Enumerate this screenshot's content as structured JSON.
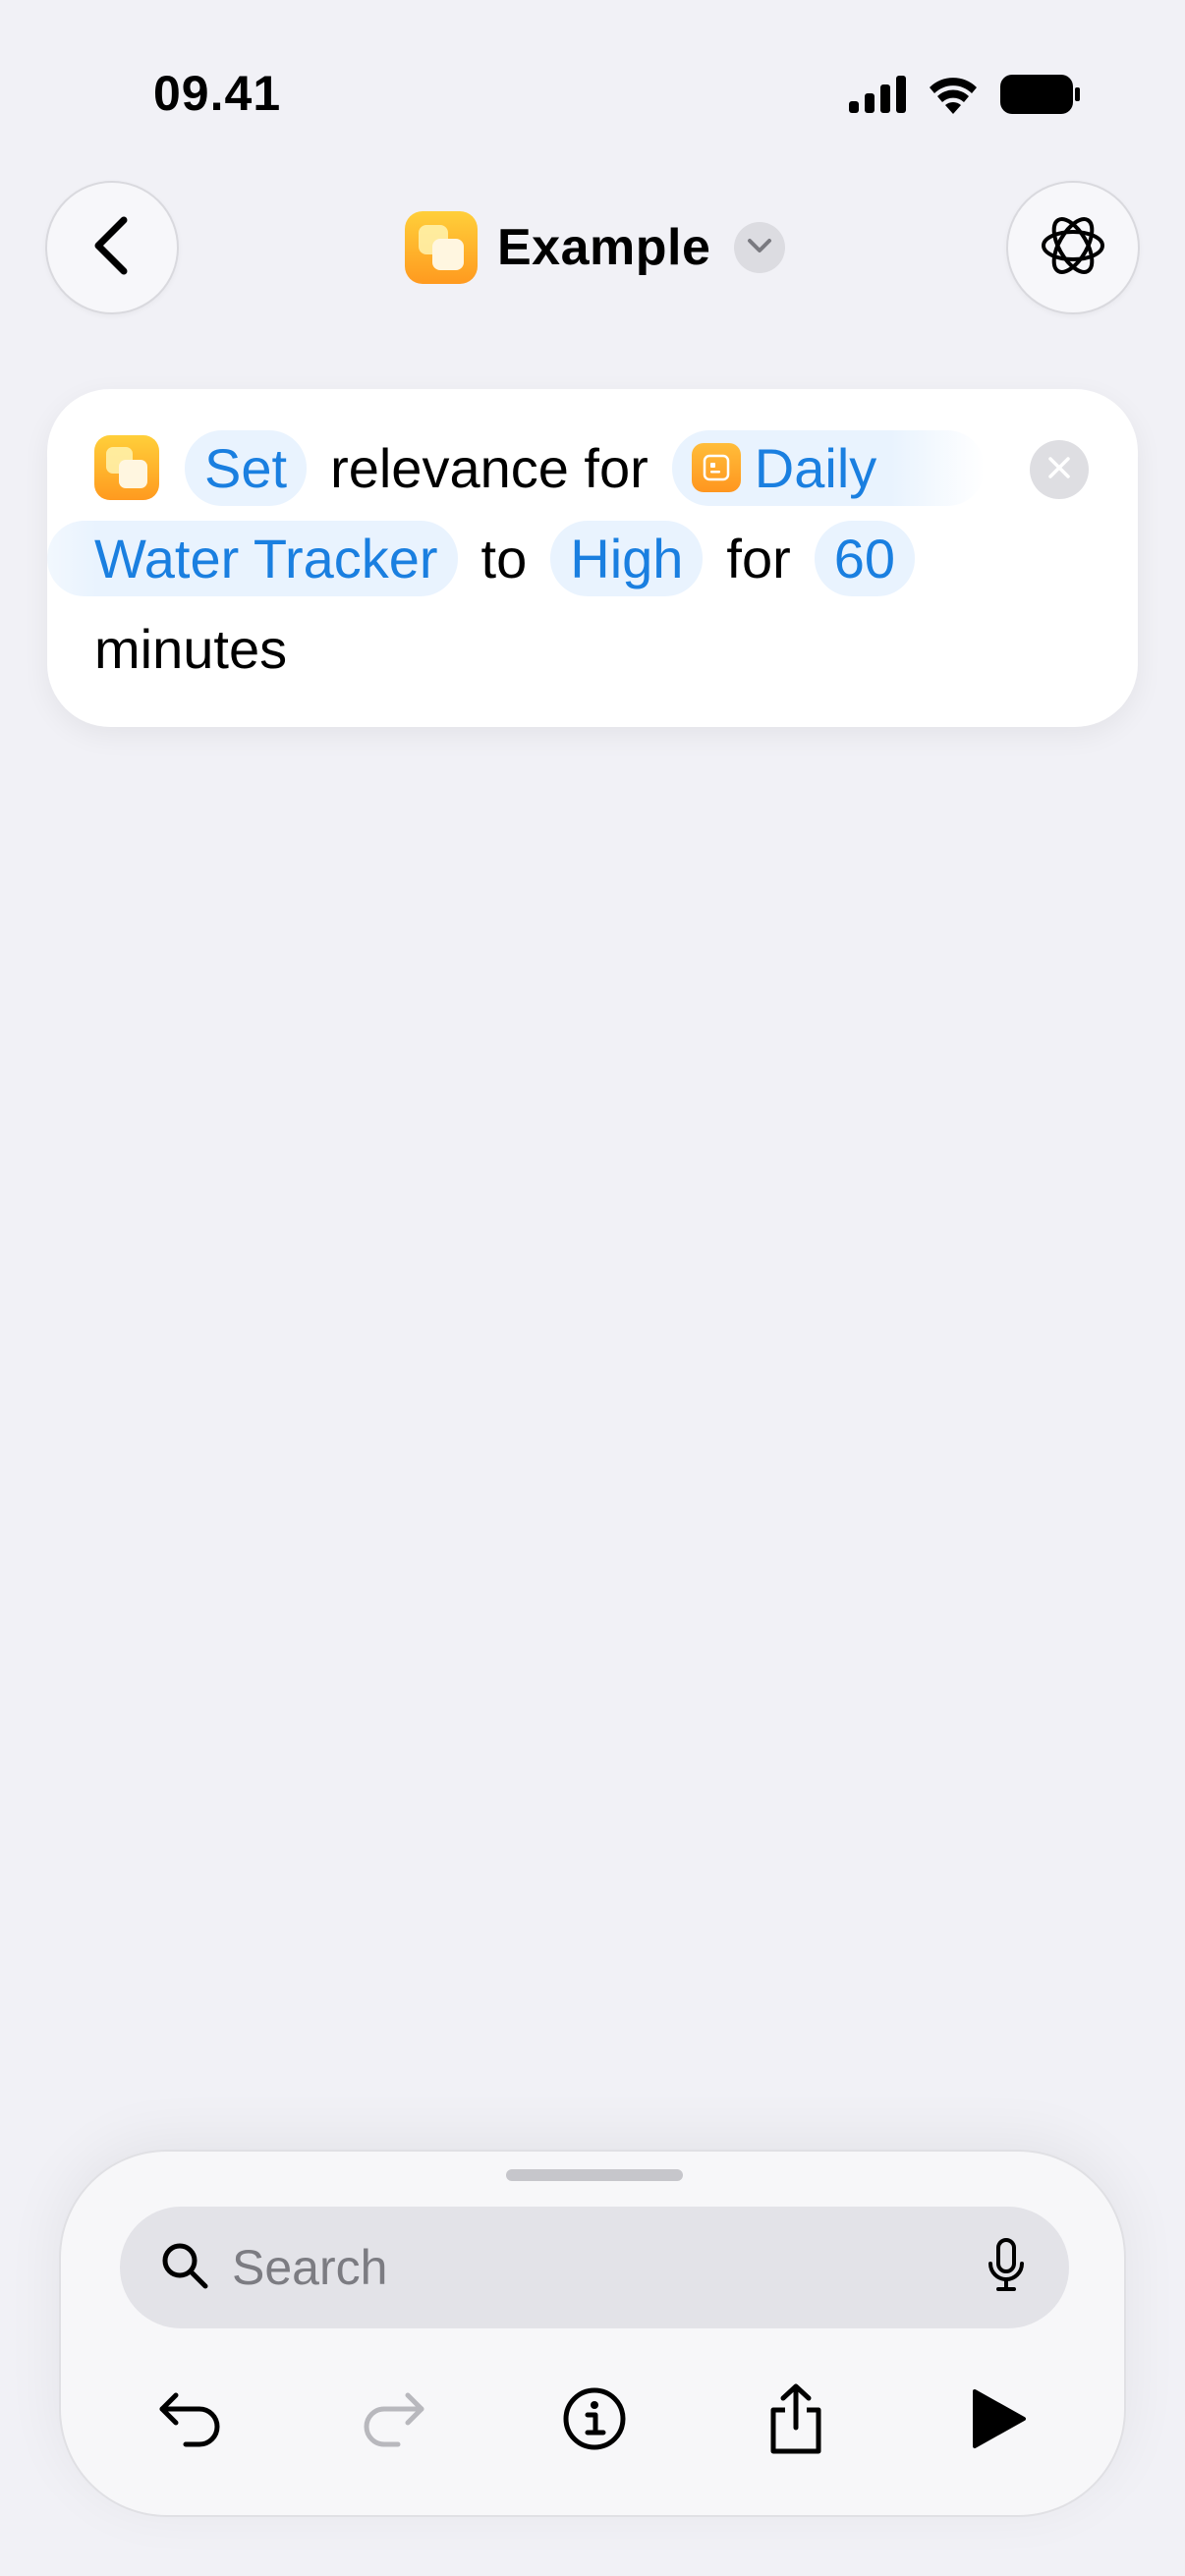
{
  "status_bar": {
    "time": "09.41",
    "icons": [
      "cellular-signal-icon",
      "wifi-icon",
      "battery-icon"
    ]
  },
  "nav": {
    "back_icon": "chevron-left-icon",
    "title": "Example",
    "title_menu_icon": "chevron-down-icon",
    "ai_icon": "apple-intelligence-icon"
  },
  "action": {
    "verb": "Set",
    "text1": "relevance for",
    "app_part1": "Daily",
    "app_part2": "Water Tracker",
    "text2": "to",
    "level": "High",
    "text3": "for",
    "duration": "60",
    "unit": "minutes",
    "remove_icon": "close-icon"
  },
  "bottom": {
    "search_placeholder": "Search",
    "tools": [
      "undo-icon",
      "redo-icon",
      "info-icon",
      "share-icon",
      "play-icon"
    ]
  },
  "colors": {
    "accent": "#1a7fe0",
    "token_bg": "#e9f3fe",
    "background": "#f1f1f6",
    "app_icon_top": "#ffcf3a",
    "app_icon_bottom": "#ff9a1f"
  }
}
